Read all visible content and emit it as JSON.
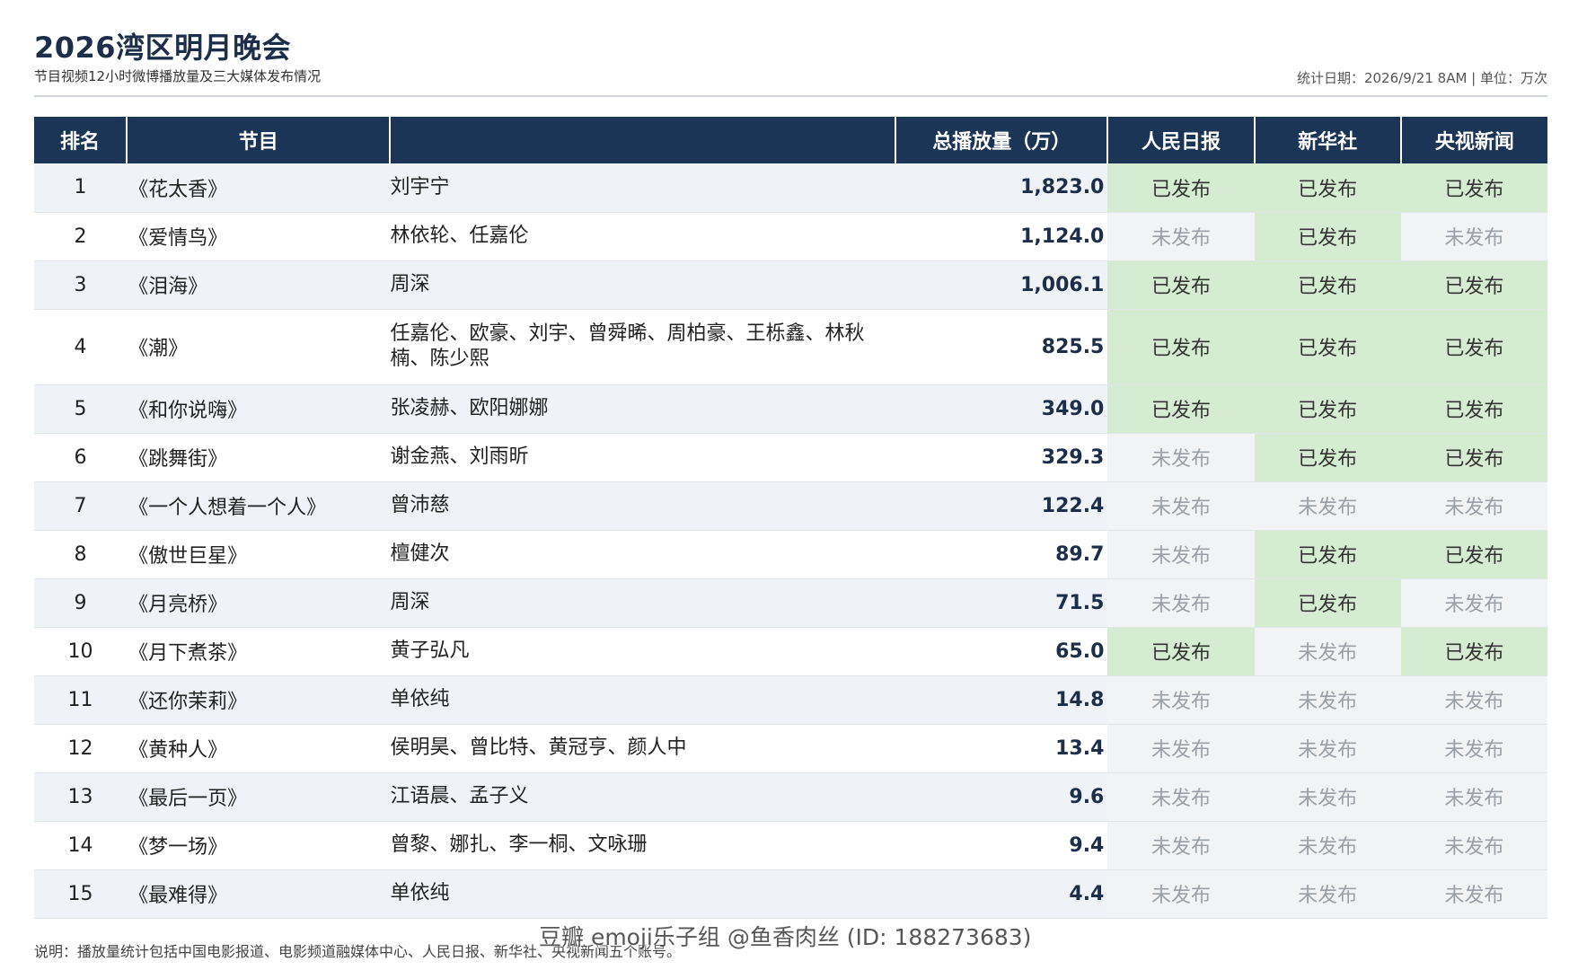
{
  "header": {
    "title": "2026湾区明月晚会",
    "subtitle": "节目视频12小时微博播放量及三大媒体发布情况",
    "meta": "统计日期：2026/9/21 8AM | 单位：万次"
  },
  "table": {
    "columns": {
      "rank": "排名",
      "program": "节目",
      "artists": "",
      "total": "总播放量（万）",
      "media1": "人民日报",
      "media2": "新华社",
      "media3": "央视新闻"
    },
    "rows": [
      {
        "rank": "1",
        "program": "《花太香》",
        "artists": "刘宇宁",
        "total": "1,823.0",
        "m1": "已发布",
        "m2": "已发布",
        "m3": "已发布"
      },
      {
        "rank": "2",
        "program": "《爱情鸟》",
        "artists": "林依轮、任嘉伦",
        "total": "1,124.0",
        "m1": "未发布",
        "m2": "已发布",
        "m3": "未发布"
      },
      {
        "rank": "3",
        "program": "《泪海》",
        "artists": "周深",
        "total": "1,006.1",
        "m1": "已发布",
        "m2": "已发布",
        "m3": "已发布"
      },
      {
        "rank": "4",
        "program": "《潮》",
        "artists": "任嘉伦、欧豪、刘宇、曾舜晞、周柏豪、王栎鑫、林秋楠、陈少熙",
        "total": "825.5",
        "m1": "已发布",
        "m2": "已发布",
        "m3": "已发布"
      },
      {
        "rank": "5",
        "program": "《和你说嗨》",
        "artists": "张凌赫、欧阳娜娜",
        "total": "349.0",
        "m1": "已发布",
        "m2": "已发布",
        "m3": "已发布"
      },
      {
        "rank": "6",
        "program": "《跳舞街》",
        "artists": "谢金燕、刘雨昕",
        "total": "329.3",
        "m1": "未发布",
        "m2": "已发布",
        "m3": "已发布"
      },
      {
        "rank": "7",
        "program": "《一个人想着一个人》",
        "artists": "曾沛慈",
        "total": "122.4",
        "m1": "未发布",
        "m2": "未发布",
        "m3": "未发布"
      },
      {
        "rank": "8",
        "program": "《傲世巨星》",
        "artists": "檀健次",
        "total": "89.7",
        "m1": "未发布",
        "m2": "已发布",
        "m3": "已发布"
      },
      {
        "rank": "9",
        "program": "《月亮桥》",
        "artists": "周深",
        "total": "71.5",
        "m1": "未发布",
        "m2": "已发布",
        "m3": "未发布"
      },
      {
        "rank": "10",
        "program": "《月下煮茶》",
        "artists": "黄子弘凡",
        "total": "65.0",
        "m1": "已发布",
        "m2": "未发布",
        "m3": "已发布"
      },
      {
        "rank": "11",
        "program": "《还你茉莉》",
        "artists": "单依纯",
        "total": "14.8",
        "m1": "未发布",
        "m2": "未发布",
        "m3": "未发布"
      },
      {
        "rank": "12",
        "program": "《黄种人》",
        "artists": "侯明昊、曾比特、黄冠亨、颜人中",
        "total": "13.4",
        "m1": "未发布",
        "m2": "未发布",
        "m3": "未发布"
      },
      {
        "rank": "13",
        "program": "《最后一页》",
        "artists": "江语晨、孟子义",
        "total": "9.6",
        "m1": "未发布",
        "m2": "未发布",
        "m3": "未发布"
      },
      {
        "rank": "14",
        "program": "《梦一场》",
        "artists": "曾黎、娜扎、李一桐、文咏珊",
        "total": "9.4",
        "m1": "未发布",
        "m2": "未发布",
        "m3": "未发布"
      },
      {
        "rank": "15",
        "program": "《最难得》",
        "artists": "单依纯",
        "total": "4.4",
        "m1": "未发布",
        "m2": "未发布",
        "m3": "未发布"
      }
    ]
  },
  "footer": {
    "note": "说明：播放量统计包括中国电影报道、电影频道融媒体中心、人民日报、新华社、央视新闻五个账号。"
  },
  "watermark": {
    "text": "豆瓣 emoji乐子组 @鱼香肉丝 (ID: 188273683)"
  },
  "colors": {
    "header_bg": "#1b3556",
    "published_bg": "#d6ecd2",
    "unpublished_bg": "#f1f3f5",
    "title": "#1c2e4a"
  }
}
